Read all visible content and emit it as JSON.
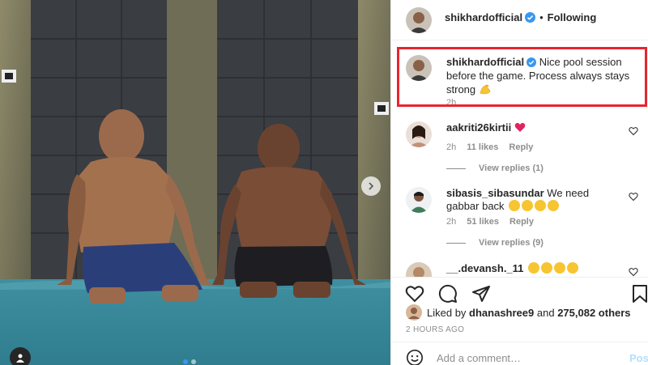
{
  "post": {
    "author": "shikhardofficial",
    "follow_state": "Following",
    "separator": "•",
    "caption": "Nice pool session before the game. Process always stays strong",
    "caption_time": "2h"
  },
  "comments": [
    {
      "user": "aakriti26kirtii",
      "text": "",
      "time": "2h",
      "likes": "11 likes",
      "reply": "Reply",
      "view_replies": "View replies (1)"
    },
    {
      "user": "sibasis_sibasundar",
      "text": "We need gabbar back",
      "time": "2h",
      "likes": "51 likes",
      "reply": "Reply",
      "view_replies": "View replies (9)"
    },
    {
      "user": "__.devansh._11",
      "text": ""
    }
  ],
  "likes": {
    "prefix": "Liked by",
    "user": "dhanashree9",
    "middle": "and",
    "count": "275,082 others"
  },
  "post_time": "2 HOURS AGO",
  "add_comment": {
    "placeholder": "Add a comment…",
    "post_label": "Post"
  },
  "colors": {
    "highlight": "#e8252e",
    "verified": "#3897f0",
    "heart": "#ed4956"
  },
  "icons": [
    "heart-icon",
    "comment-icon",
    "share-icon",
    "bookmark-icon",
    "smiley-icon",
    "verified-badge-icon",
    "flexed-biceps-emoji",
    "next-arrow-icon",
    "user-tag-icon"
  ]
}
